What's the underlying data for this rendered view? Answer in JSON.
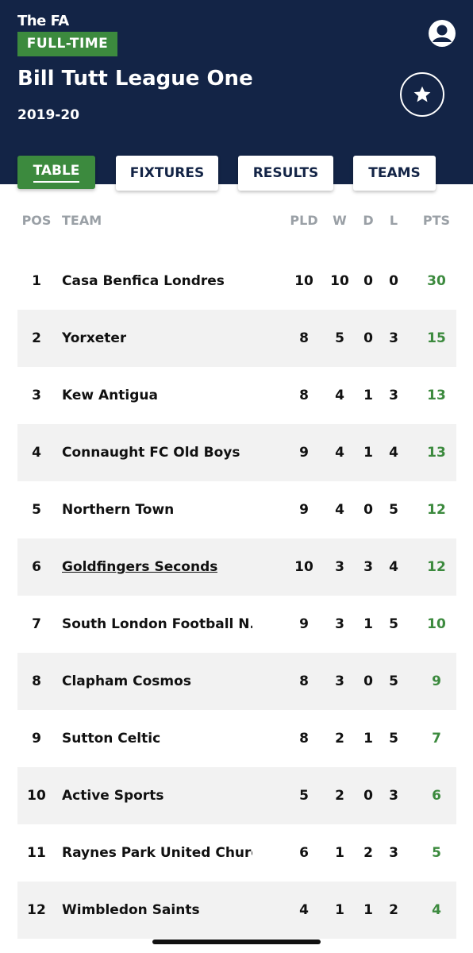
{
  "header": {
    "brand_line1": "The FA",
    "brand_badge": "FULL-TIME",
    "title": "Bill Tutt League One",
    "season": "2019-20"
  },
  "tabs": [
    {
      "label": "TABLE",
      "active": true
    },
    {
      "label": "FIXTURES",
      "active": false
    },
    {
      "label": "RESULTS",
      "active": false
    },
    {
      "label": "TEAMS",
      "active": false
    }
  ],
  "table": {
    "columns": {
      "pos": "POS",
      "team": "TEAM",
      "pld": "PLD",
      "w": "W",
      "d": "D",
      "l": "L",
      "pts": "PTS"
    },
    "rows": [
      {
        "pos": "1",
        "team": "Casa Benfica Londres",
        "pld": "10",
        "w": "10",
        "d": "0",
        "l": "0",
        "pts": "30"
      },
      {
        "pos": "2",
        "team": "Yorxeter",
        "pld": "8",
        "w": "5",
        "d": "0",
        "l": "3",
        "pts": "15"
      },
      {
        "pos": "3",
        "team": "Kew Antigua",
        "pld": "8",
        "w": "4",
        "d": "1",
        "l": "3",
        "pts": "13"
      },
      {
        "pos": "4",
        "team": "Connaught FC Old Boys",
        "pld": "9",
        "w": "4",
        "d": "1",
        "l": "4",
        "pts": "13"
      },
      {
        "pos": "5",
        "team": "Northern Town",
        "pld": "9",
        "w": "4",
        "d": "0",
        "l": "5",
        "pts": "12"
      },
      {
        "pos": "6",
        "team": "Goldfingers Seconds",
        "pld": "10",
        "w": "3",
        "d": "3",
        "l": "4",
        "pts": "12"
      },
      {
        "pos": "7",
        "team": "South London Football N...",
        "pld": "9",
        "w": "3",
        "d": "1",
        "l": "5",
        "pts": "10"
      },
      {
        "pos": "8",
        "team": "Clapham Cosmos",
        "pld": "8",
        "w": "3",
        "d": "0",
        "l": "5",
        "pts": "9"
      },
      {
        "pos": "9",
        "team": "Sutton Celtic",
        "pld": "8",
        "w": "2",
        "d": "1",
        "l": "5",
        "pts": "7"
      },
      {
        "pos": "10",
        "team": "Active Sports",
        "pld": "5",
        "w": "2",
        "d": "0",
        "l": "3",
        "pts": "6"
      },
      {
        "pos": "11",
        "team": "Raynes Park United Churc...",
        "pld": "6",
        "w": "1",
        "d": "2",
        "l": "3",
        "pts": "5"
      },
      {
        "pos": "12",
        "team": "Wimbledon Saints",
        "pld": "4",
        "w": "1",
        "d": "1",
        "l": "2",
        "pts": "4"
      }
    ]
  },
  "icons": {
    "avatar": "user-icon",
    "favourite": "star-icon"
  },
  "colors": {
    "header_bg": "#132446",
    "accent_green": "#3c8a3e",
    "row_alt": "#f2f2f2"
  }
}
